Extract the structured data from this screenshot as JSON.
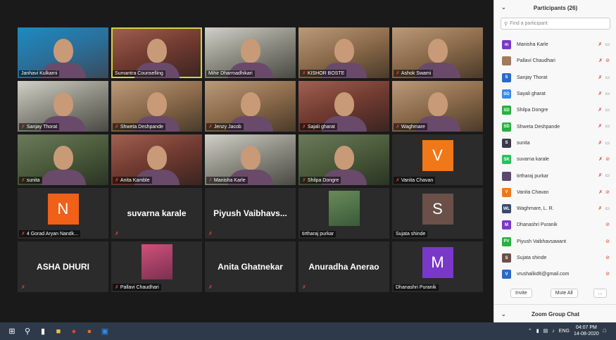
{
  "tiles": [
    {
      "name": "Janhavi Kulkarni",
      "kind": "cam",
      "variant": "v1",
      "muted": false
    },
    {
      "name": "Sumantra Counselling",
      "kind": "cam",
      "variant": "v5",
      "muted": false,
      "active": true
    },
    {
      "name": "Mihir Dharmadhikari",
      "kind": "cam",
      "variant": "v3",
      "muted": false
    },
    {
      "name": "KISHOR BOSTE",
      "kind": "cam",
      "variant": "v2",
      "muted": true
    },
    {
      "name": "Ashok Swami",
      "kind": "cam",
      "variant": "v2",
      "muted": true
    },
    {
      "name": "Sanjay Thorat",
      "kind": "cam",
      "variant": "v3",
      "muted": true
    },
    {
      "name": "Shweta Deshpande",
      "kind": "cam",
      "variant": "v2",
      "muted": true
    },
    {
      "name": "Jenzy Jacob",
      "kind": "cam",
      "variant": "v2",
      "muted": true
    },
    {
      "name": "Sajali gharat",
      "kind": "cam",
      "variant": "v5",
      "muted": true
    },
    {
      "name": "Waghmare",
      "kind": "cam",
      "variant": "v2",
      "muted": true
    },
    {
      "name": "sunita",
      "kind": "cam",
      "variant": "v4",
      "muted": true
    },
    {
      "name": "Anita Kamble",
      "kind": "cam",
      "variant": "v5",
      "muted": true
    },
    {
      "name": "Manisha Karle",
      "kind": "cam",
      "variant": "v3",
      "muted": true
    },
    {
      "name": "Shilpa Dongre",
      "kind": "cam",
      "variant": "v4",
      "muted": true
    },
    {
      "name": "Vanita Chavan",
      "kind": "avatar",
      "letter": "V",
      "color": "#f07818",
      "muted": true
    },
    {
      "name": "4 Gorad Aryan Nandk...",
      "kind": "avatar",
      "letter": "N",
      "color": "#f06018",
      "muted": true
    },
    {
      "name": "",
      "kind": "bigname",
      "big": "suvarna karale",
      "muted": true
    },
    {
      "name": "",
      "kind": "bigname",
      "big": "Piyush  Vaibhavs...",
      "muted": true
    },
    {
      "name": "tirtharaj purkar",
      "kind": "thumb",
      "thumb": "",
      "muted": false
    },
    {
      "name": "Sujata shinde",
      "kind": "avatar",
      "letter": "S",
      "color": "#6a5048",
      "muted": false
    },
    {
      "name": "",
      "kind": "bigname",
      "big": "ASHA DHURI",
      "muted": true
    },
    {
      "name": "Pallavi Chaudhari",
      "kind": "thumb",
      "thumb": "pink",
      "muted": true
    },
    {
      "name": "",
      "kind": "bigname",
      "big": "Anita Ghatnekar",
      "muted": true
    },
    {
      "name": "",
      "kind": "bigname",
      "big": "Anuradha Anerao",
      "muted": true
    },
    {
      "name": "Dhanashri Puranik",
      "kind": "avatar",
      "letter": "M",
      "color": "#7a38c8",
      "muted": false
    }
  ],
  "panel": {
    "title": "Participants (26)",
    "search_placeholder": "Find a participant",
    "participants": [
      {
        "initials": "m",
        "color": "#7a38c8",
        "name": "Manisha Karle",
        "mic_off": true,
        "cam_off": false
      },
      {
        "initials": "",
        "color": "#a07a5a",
        "name": "Pallavi Chaudhari",
        "mic_off": true,
        "cam_off": true
      },
      {
        "initials": "S",
        "color": "#2a6ac8",
        "name": "Sanjay Thorat",
        "mic_off": true,
        "cam_off": false
      },
      {
        "initials": "SG",
        "color": "#3a8ae8",
        "name": "Sayali gharat",
        "mic_off": true,
        "cam_off": false
      },
      {
        "initials": "SD",
        "color": "#28b040",
        "name": "Shilpa Dongre",
        "mic_off": true,
        "cam_off": false
      },
      {
        "initials": "SD",
        "color": "#28b040",
        "name": "Shweta Deshpande",
        "mic_off": true,
        "cam_off": false
      },
      {
        "initials": "S",
        "color": "#3a3a4a",
        "name": "sunita",
        "mic_off": true,
        "cam_off": false
      },
      {
        "initials": "SK",
        "color": "#28c060",
        "name": "suvarna karale",
        "mic_off": true,
        "cam_off": true
      },
      {
        "initials": "",
        "color": "#5a4a6a",
        "name": "tirtharaj purkar",
        "mic_off": true,
        "cam_off": false
      },
      {
        "initials": "V",
        "color": "#f07818",
        "name": "Vanita Chavan",
        "mic_off": true,
        "cam_off": true
      },
      {
        "initials": "WL",
        "color": "#3a4a6a",
        "name": "Waghmare,  L. R.",
        "mic_off": true,
        "cam_off": false
      },
      {
        "initials": "M",
        "color": "#7a38c8",
        "name": "Dhanashri Puranik",
        "mic_off": false,
        "cam_off": true
      },
      {
        "initials": "PV",
        "color": "#28b040",
        "name": "Piyush Vaibhavsawant",
        "mic_off": false,
        "cam_off": true
      },
      {
        "initials": "S",
        "color": "#6a5048",
        "name": "Sujata shinde",
        "mic_off": false,
        "cam_off": true
      },
      {
        "initials": "V",
        "color": "#2a6ac8",
        "name": "vrushalikd6@gmail.com",
        "mic_off": false,
        "cam_off": true
      }
    ],
    "invite_label": "Invite",
    "mute_all_label": "Mute All",
    "more_label": "...",
    "chat_title": "Zoom Group Chat"
  },
  "taskbar": {
    "lang": "ENG",
    "time": "04:07 PM",
    "date": "14-08-2020"
  }
}
